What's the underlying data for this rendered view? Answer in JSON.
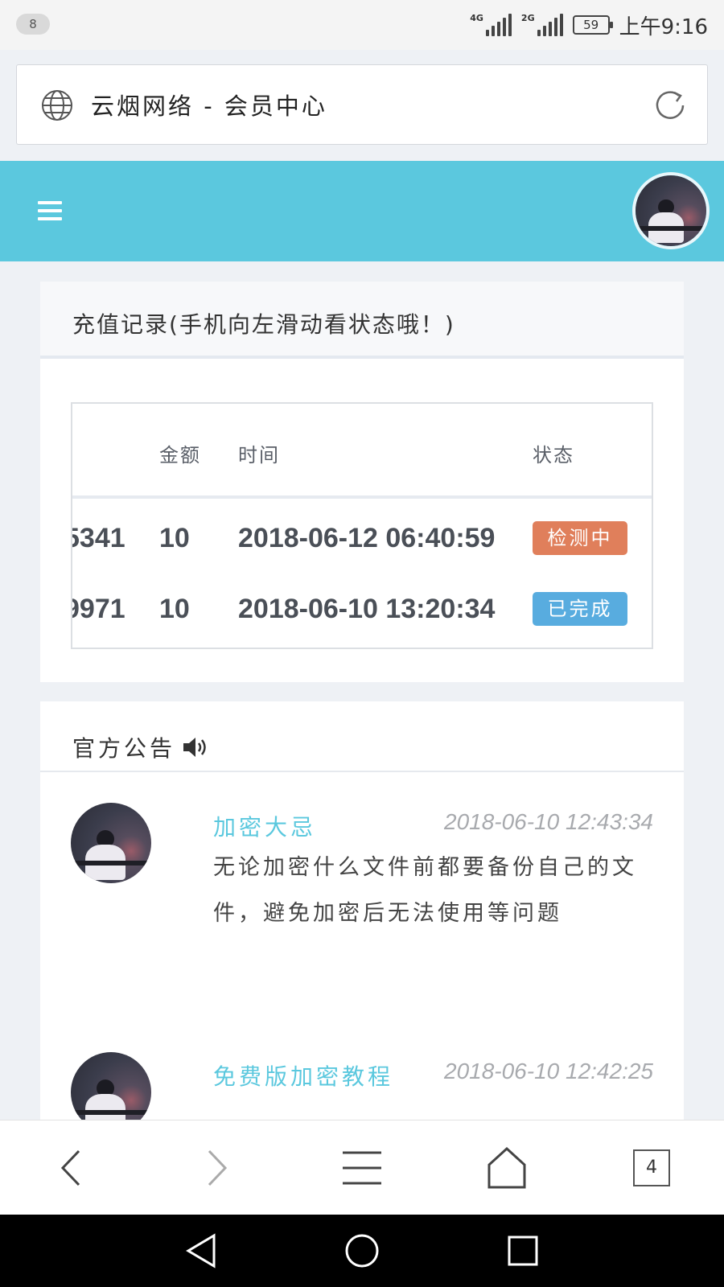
{
  "status_bar": {
    "notification_count": "8",
    "network1": "4G",
    "network2": "2G",
    "battery": "59",
    "time": "上午9:16"
  },
  "address_bar": {
    "title": "云烟网络 - 会员中心"
  },
  "header": {
    "accent_color": "#5bc8de"
  },
  "recharge": {
    "title": "充值记录(手机向左滑动看状态哦！)",
    "columns": [
      "金额",
      "时间",
      "状态"
    ],
    "rows": [
      {
        "order": "5341",
        "amount": "10",
        "time": "2018-06-12 06:40:59",
        "status": "检测中",
        "status_color": "#e07f5b"
      },
      {
        "order": "9971",
        "amount": "10",
        "time": "2018-06-10 13:20:34",
        "status": "已完成",
        "status_color": "#58acdf"
      }
    ]
  },
  "notices": {
    "title": "官方公告",
    "items": [
      {
        "title": "加密大忌",
        "time": "2018-06-10 12:43:34",
        "body": "无论加密什么文件前都要备份自己的文件，避免加密后无法使用等问题"
      },
      {
        "title": "免费版加密教程",
        "time": "2018-06-10 12:42:25",
        "body": ""
      }
    ]
  },
  "toolbar": {
    "tabs_count": "4"
  }
}
